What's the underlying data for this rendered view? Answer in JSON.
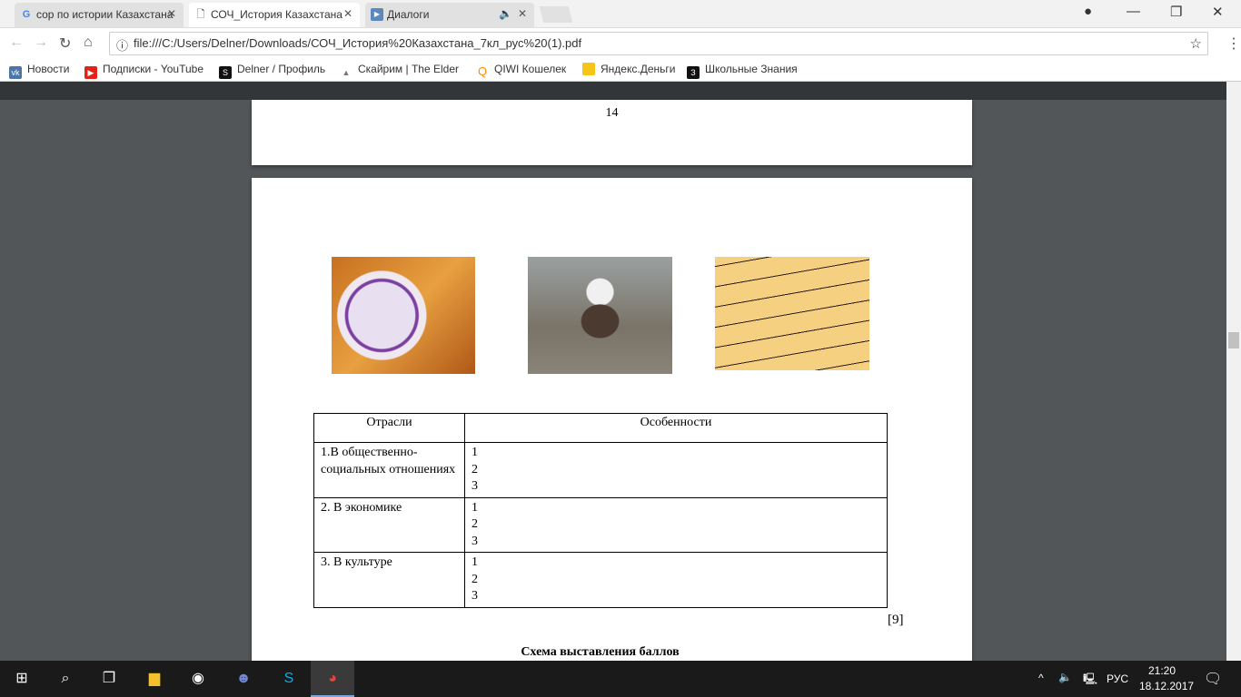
{
  "browser": {
    "tabs": [
      {
        "title": "сор по истории Казахстана",
        "icon": "google-icon",
        "active": false
      },
      {
        "title": "СОЧ_История Казахстана",
        "icon": "document-icon",
        "active": true
      },
      {
        "title": "Диалоги",
        "icon": "vk-video-icon",
        "active": false,
        "audio": true
      }
    ],
    "url": "file:///C:/Users/Delner/Downloads/СОЧ_История%20Казахстана_7кл_рус%20(1).pdf",
    "bookmarks": [
      {
        "label": "Новости",
        "icon": "vk-icon",
        "color": "#4a76a8"
      },
      {
        "label": "Подписки - YouTube",
        "icon": "youtube-icon",
        "color": "#e62117"
      },
      {
        "label": "Delner / Профиль",
        "icon": "s-icon",
        "color": "#111111"
      },
      {
        "label": "Скайрим | The Elder",
        "icon": "skyrim-icon",
        "color": "#777777"
      },
      {
        "label": "QIWI Кошелек",
        "icon": "qiwi-icon",
        "color": "#ff8c00"
      },
      {
        "label": "Яндекс.Деньги",
        "icon": "yandex-money-icon",
        "color": "#f5c518"
      },
      {
        "label": "Школьные Знания",
        "icon": "znanija-icon",
        "color": "#111111"
      }
    ]
  },
  "pdf": {
    "page_number": "14",
    "table": {
      "headers": [
        "Отрасли",
        "Особенности"
      ],
      "rows": [
        {
          "branch": "1.В общественно-социальных отношениях",
          "items": [
            "1",
            "2",
            "3"
          ]
        },
        {
          "branch": "2. В экономике",
          "items": [
            "1",
            "2",
            "3"
          ]
        },
        {
          "branch": "3. В культуре",
          "items": [
            "1",
            "2",
            "3"
          ]
        }
      ]
    },
    "score": "[9]",
    "next_heading": "Схема выставления баллов"
  },
  "taskbar": {
    "lang": "РУС",
    "time": "21:20",
    "date": "18.12.2017"
  }
}
